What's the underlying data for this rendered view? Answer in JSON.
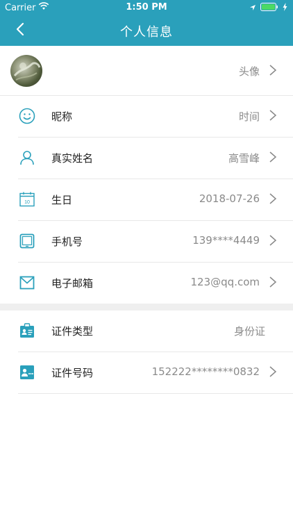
{
  "status_bar": {
    "carrier": "Carrier",
    "time": "1:50 PM"
  },
  "nav": {
    "title": "个人信息"
  },
  "avatar_row": {
    "value": "头像"
  },
  "rows": [
    {
      "label": "昵称",
      "value": "时间",
      "icon": "smile-icon"
    },
    {
      "label": "真实姓名",
      "value": "高雪峰",
      "icon": "person-icon"
    },
    {
      "label": "生日",
      "value": "2018-07-26",
      "icon": "calendar-icon",
      "calendar_day": "10"
    },
    {
      "label": "手机号",
      "value": "139****4449",
      "icon": "phone-icon"
    },
    {
      "label": "电子邮箱",
      "value": "123@qq.com",
      "icon": "mail-icon"
    }
  ],
  "id_rows": [
    {
      "label": "证件类型",
      "value": "身份证",
      "icon": "id-badge-icon"
    },
    {
      "label": "证件号码",
      "value": "152222********0832",
      "icon": "id-card-icon"
    }
  ],
  "colors": {
    "accent": "#2aa0bb"
  }
}
